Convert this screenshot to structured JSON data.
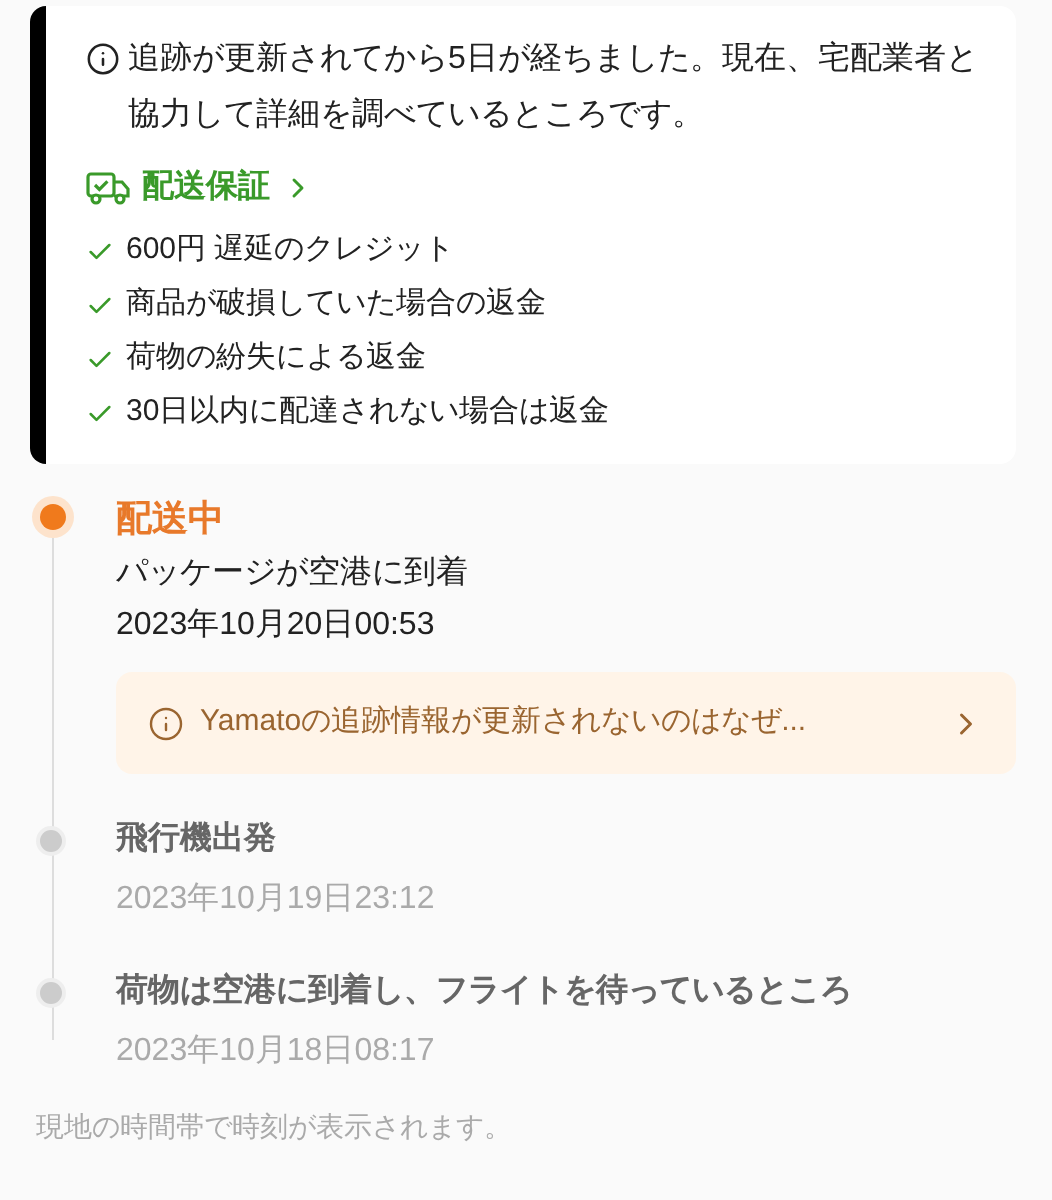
{
  "notice_card": {
    "message": "追跡が更新されてから5日が経ちました。現在、宅配業者と協力して詳細を調べているところです。",
    "guarantee_link": "配送保証",
    "guarantees": [
      "600円 遅延のクレジット",
      "商品が破損していた場合の返金",
      "荷物の紛失による返金",
      "30日以内に配達されない場合は返金"
    ]
  },
  "events": [
    {
      "current": true,
      "title": "配送中",
      "description": "パッケージが空港に到着",
      "time": "2023年10月20日00:53",
      "notice": "Yamatoの追跡情報が更新されないのはなぜ..."
    },
    {
      "current": false,
      "title": "飛行機出発",
      "time": "2023年10月19日23:12"
    },
    {
      "current": false,
      "title": "荷物は空港に到着し、フライトを待っているところ",
      "time": "2023年10月18日08:17"
    }
  ],
  "footer": "現地の時間帯で時刻が表示されます。"
}
